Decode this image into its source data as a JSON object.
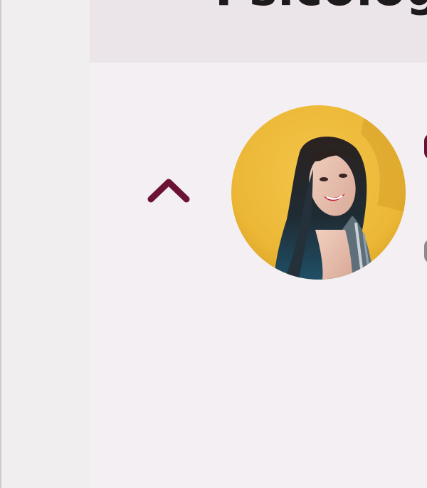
{
  "header": {
    "title_partial": "Psicologo"
  },
  "colors": {
    "accent": "#6b1236",
    "background": "#f4eff2",
    "header_band": "#ebe5e9",
    "muted_dot": "#8c8a8b"
  },
  "icons": {
    "scroll_up": "chevron-up-icon",
    "avatar": "profile-photo"
  }
}
